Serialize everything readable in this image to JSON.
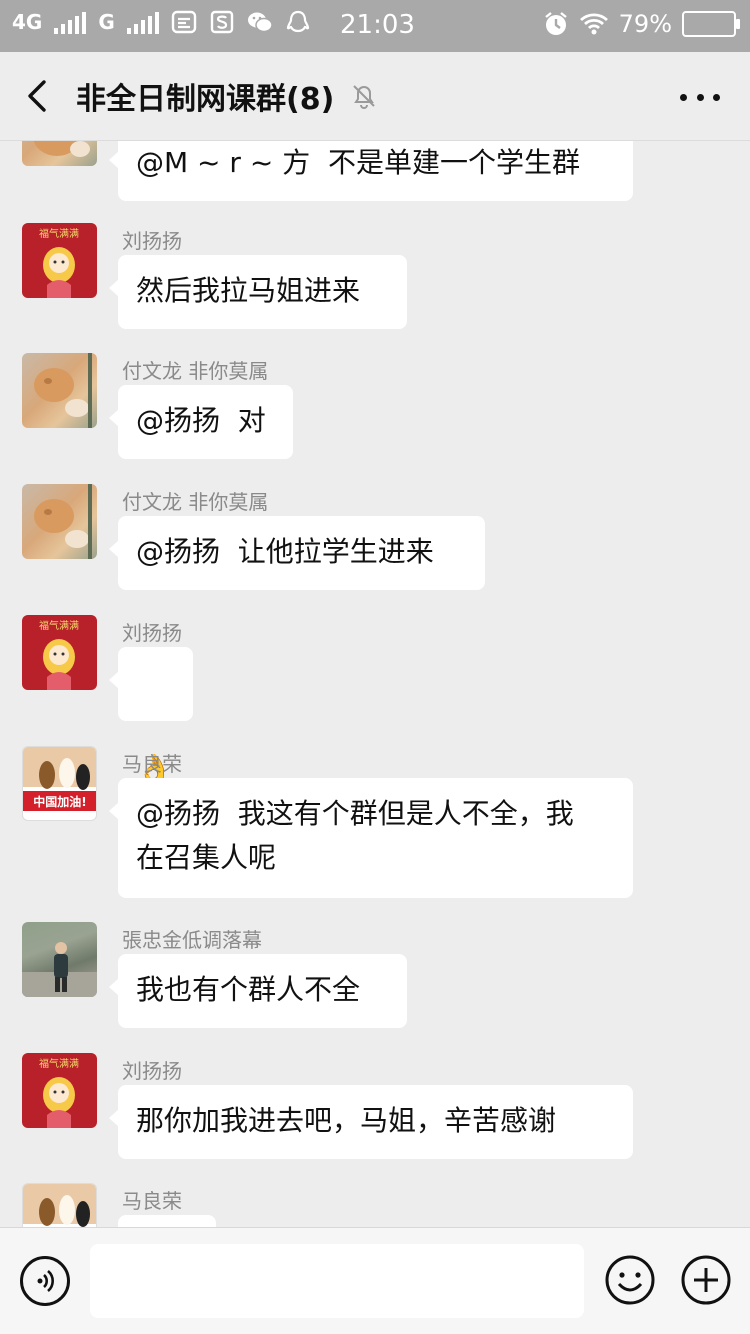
{
  "status_bar": {
    "network_4g": "4G",
    "network_g": "G",
    "time": "21:03",
    "battery": "79%"
  },
  "header": {
    "title": "非全日制网课群(8)"
  },
  "messages": [
    {
      "sender": "",
      "text": "@M ~ r ~ 方  不是单建一个学生群",
      "avatar": "cat-avatar"
    },
    {
      "sender": "刘扬扬",
      "text": "然后我拉马姐进来",
      "avatar": "cartoon-girl-avatar"
    },
    {
      "sender": "付文龙  非你莫属",
      "text": "@扬扬  对",
      "avatar": "cat-avatar"
    },
    {
      "sender": "付文龙  非你莫属",
      "text": "@扬扬  让他拉学生进来",
      "avatar": "cat-avatar"
    },
    {
      "sender": "刘扬扬",
      "text": "👌",
      "avatar": "cartoon-girl-avatar"
    },
    {
      "sender": "马良荣",
      "text": "@扬扬  我这有个群但是人不全，我\n在召集人呢",
      "avatar": "alpaca-avatar"
    },
    {
      "sender": "張忠金低调落幕",
      "text": "我也有个群人不全",
      "avatar": "person-photo-avatar"
    },
    {
      "sender": "刘扬扬",
      "text": "那你加我进去吧，马姐，辛苦感谢",
      "avatar": "cartoon-girl-avatar"
    },
    {
      "sender": "马良荣",
      "text": "",
      "avatar": "alpaca-avatar"
    }
  ],
  "avatar_text": {
    "red_banner": "福气满满",
    "alpaca_banner": "中国加油!"
  },
  "input": {
    "placeholder": "",
    "value": ""
  },
  "colors": {
    "background": "#ededed",
    "bubble": "#ffffff",
    "status_bar": "#a9a9a9",
    "sender_name": "#8a8a8a"
  }
}
